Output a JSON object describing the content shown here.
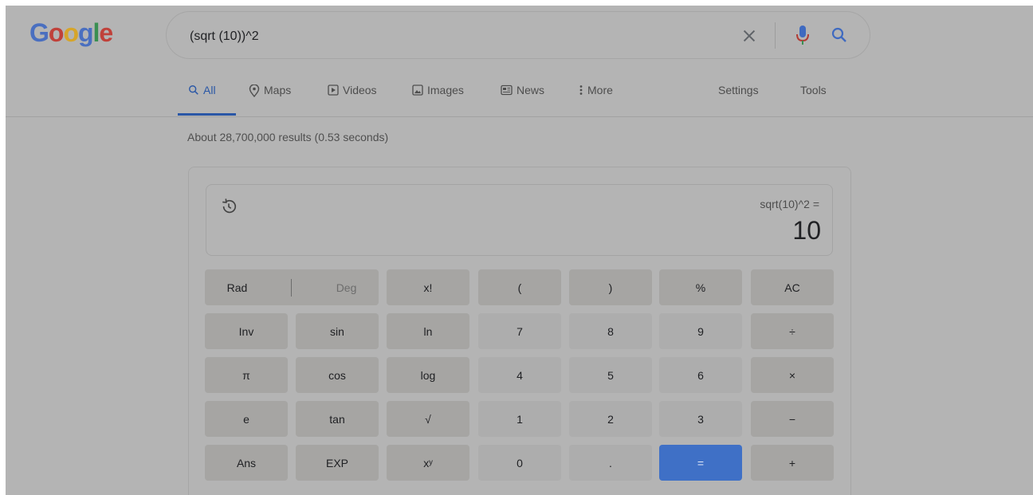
{
  "search": {
    "query": "(sqrt (10))^2",
    "icons": [
      "clear-icon",
      "mic-icon",
      "search-icon"
    ]
  },
  "logo": {
    "letters": [
      "G",
      "o",
      "o",
      "g",
      "l",
      "e"
    ],
    "colors": [
      "#4a6fc0",
      "#c0413a",
      "#d6a52a",
      "#4a6fc0",
      "#3a8f52",
      "#c0413a"
    ]
  },
  "tabs": {
    "all": "All",
    "maps": "Maps",
    "videos": "Videos",
    "images": "Images",
    "news": "News",
    "more": "More",
    "settings": "Settings",
    "tools": "Tools",
    "accent": "#2a57a6"
  },
  "result_stats": "About 28,700,000 results (0.53 seconds)",
  "calculator": {
    "expression": "sqrt(10)^2 =",
    "result": "10",
    "keys": {
      "rad": "Rad",
      "deg": "Deg",
      "fact": "x!",
      "lparen": "(",
      "rparen": ")",
      "percent": "%",
      "ac": "AC",
      "inv": "Inv",
      "sin": "sin",
      "ln": "ln",
      "k7": "7",
      "k8": "8",
      "k9": "9",
      "divide": "÷",
      "pi": "π",
      "cos": "cos",
      "log": "log",
      "k4": "4",
      "k5": "5",
      "k6": "6",
      "multiply": "×",
      "e": "e",
      "tan": "tan",
      "sqrt": "√",
      "k1": "1",
      "k2": "2",
      "k3": "3",
      "minus": "−",
      "ans": "Ans",
      "exp": "EXP",
      "pow": "xʸ",
      "k0": "0",
      "dot": ".",
      "equals": "=",
      "plus": "+"
    },
    "equals_color": "#3f70c6"
  }
}
